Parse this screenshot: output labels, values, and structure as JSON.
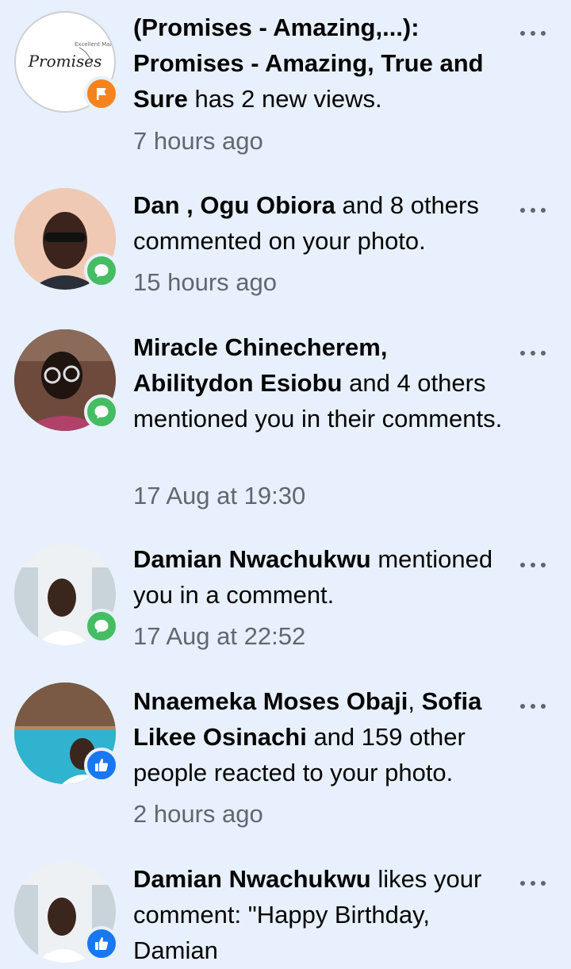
{
  "colors": {
    "background": "#e7f0fc",
    "time_text": "#606770",
    "badge_page": "#f5841f",
    "badge_comment": "#45bd62",
    "badge_like": "#1877f2"
  },
  "notifications": [
    {
      "avatar_logo_text": "Promises",
      "avatar_logo_sub": "Excellent Mark",
      "badge_icon": "flag-icon",
      "parts": [
        {
          "b": true,
          "t": "(Promises - Amazing,...):"
        },
        {
          "b": true,
          "t": " Promises - Amazing, True and Sure"
        },
        {
          "b": false,
          "t": " has 2 new views."
        }
      ],
      "time": "7 hours ago"
    },
    {
      "badge_icon": "comment-icon",
      "parts": [
        {
          "b": true,
          "t": "Dan , Ogu Obiora"
        },
        {
          "b": false,
          "t": " and 8 others commented on your photo."
        }
      ],
      "time": "15 hours ago"
    },
    {
      "badge_icon": "comment-icon",
      "parts": [
        {
          "b": true,
          "t": "Miracle Chinecherem, Abilitydon Esiobu"
        },
        {
          "b": false,
          "t": " and 4 others mentioned you in their comments."
        }
      ],
      "time": "17 Aug at 19:30"
    },
    {
      "badge_icon": "comment-icon",
      "parts": [
        {
          "b": true,
          "t": "Damian Nwachukwu"
        },
        {
          "b": false,
          "t": " mentioned you in a comment."
        }
      ],
      "time": "17 Aug at 22:52"
    },
    {
      "badge_icon": "like-icon",
      "parts": [
        {
          "b": true,
          "t": "Nnaemeka Moses Obaji"
        },
        {
          "b": false,
          "t": ", "
        },
        {
          "b": true,
          "t": "Sofia Likee Osinachi"
        },
        {
          "b": false,
          "t": " and 159 other people reacted to your photo."
        }
      ],
      "time": "2 hours ago"
    },
    {
      "badge_icon": "like-icon",
      "parts": [
        {
          "b": true,
          "t": "Damian Nwachukwu"
        },
        {
          "b": false,
          "t": " likes your comment: \"Happy Birthday, Damian"
        }
      ],
      "time": ""
    }
  ]
}
